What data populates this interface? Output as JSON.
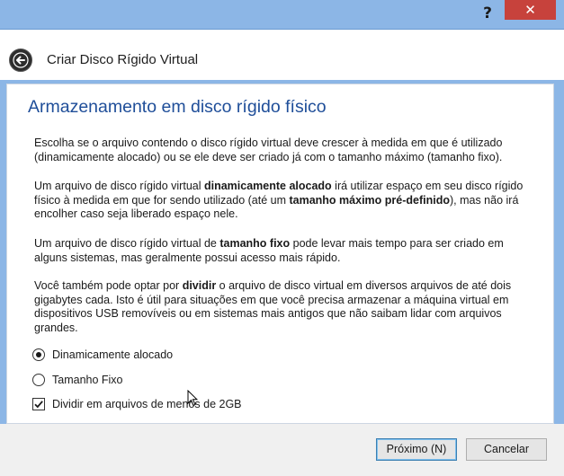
{
  "titlebar": {
    "help_label": "?",
    "close_label": "✕"
  },
  "header": {
    "back_icon": "back-arrow-icon",
    "title": "Criar Disco Rígido Virtual"
  },
  "main": {
    "page_title": "Armazenamento em disco rígido físico",
    "paragraphs": [
      [
        {
          "t": "Escolha se o arquivo contendo o disco rígido virtual deve crescer à medida em que é utilizado (dinamicamente alocado) ou se ele deve ser criado já com o tamanho máximo (tamanho fixo).",
          "b": false
        }
      ],
      [
        {
          "t": "Um arquivo de disco rígido virtual ",
          "b": false
        },
        {
          "t": "dinamicamente alocado",
          "b": true
        },
        {
          "t": " irá utilizar espaço em seu disco rígido físico à medida em que for sendo utilizado (até um ",
          "b": false
        },
        {
          "t": "tamanho máximo pré-definido",
          "b": true
        },
        {
          "t": "), mas não irá encolher caso seja liberado espaço nele.",
          "b": false
        }
      ],
      [
        {
          "t": "Um arquivo de disco rígido virtual de ",
          "b": false
        },
        {
          "t": "tamanho fixo",
          "b": true
        },
        {
          "t": " pode levar mais tempo para ser criado em alguns sistemas, mas geralmente possui acesso mais rápido.",
          "b": false
        }
      ],
      [
        {
          "t": "Você também pode optar por ",
          "b": false
        },
        {
          "t": "dividir",
          "b": true
        },
        {
          "t": " o arquivo de disco virtual em diversos arquivos de até dois gigabytes cada. Isto é útil para situações em que você precisa armazenar a máquina virtual em dispositivos USB removíveis ou em sistemas mais antigos que não saibam lidar com arquivos grandes.",
          "b": false
        }
      ]
    ],
    "options": {
      "dynamic_label": "Dinamicamente alocado",
      "dynamic_selected": true,
      "fixed_label": "Tamanho Fixo",
      "fixed_selected": false,
      "split_label": "Dividir em arquivos de menos de 2GB",
      "split_checked": true
    }
  },
  "footer": {
    "next_label": "Próximo (N)",
    "cancel_label": "Cancelar"
  },
  "colors": {
    "title_blue": "#1f4e99",
    "frame_blue": "#8cb6e6",
    "close_red": "#c7423c"
  }
}
